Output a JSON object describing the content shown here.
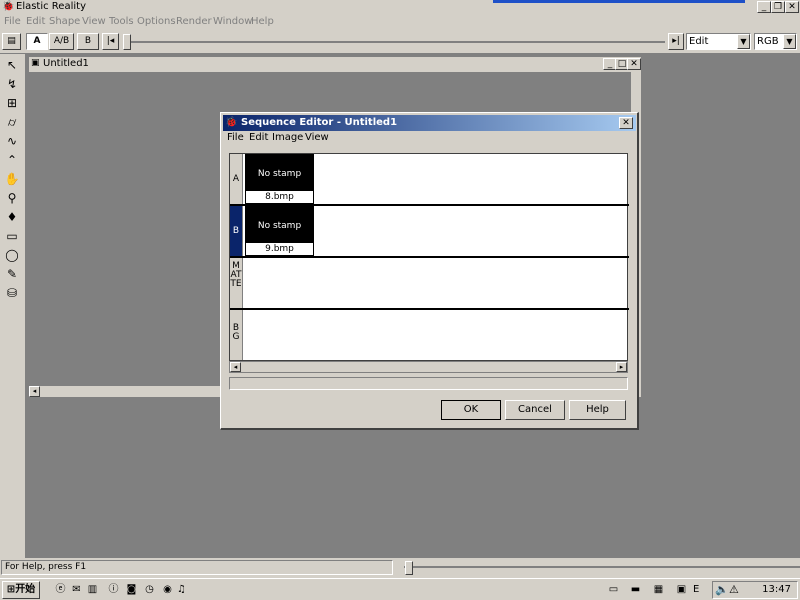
{
  "app": {
    "title": "Elastic Reality",
    "menu": [
      "File",
      "Edit",
      "Shape",
      "View",
      "Tools",
      "Options",
      "Render",
      "Window",
      "Help"
    ]
  },
  "toolbar": {
    "buttons": [
      "A",
      "A/B",
      "B"
    ],
    "mode_select": "Edit",
    "color_select": "RGB"
  },
  "palette_icons": [
    "arrow-select-icon",
    "pen-curve-icon",
    "grid-deform-icon",
    "cylinder-icon",
    "wave-icon",
    "node-edit-icon",
    "hand-icon",
    "magnifier-icon",
    "dropper-icon",
    "rectangle-icon",
    "ellipse-icon",
    "brush-icon",
    "paint-bucket-icon"
  ],
  "document": {
    "title": "Untitled1"
  },
  "dialog": {
    "title": "Sequence Editor - Untitled1",
    "menu": [
      "File",
      "Edit",
      "Image",
      "View"
    ],
    "tracks": [
      {
        "label": "A",
        "stamp": "No stamp",
        "file": "8.bmp"
      },
      {
        "label": "B",
        "stamp": "No stamp",
        "file": "9.bmp"
      },
      {
        "label": "MATTE"
      },
      {
        "label": "BG"
      }
    ],
    "buttons": {
      "ok": "OK",
      "cancel": "Cancel",
      "help": "Help"
    }
  },
  "status": {
    "text": "For Help, press F1"
  },
  "taskbar": {
    "start": "开始",
    "tray_lang": "E",
    "clock": "13:47"
  }
}
